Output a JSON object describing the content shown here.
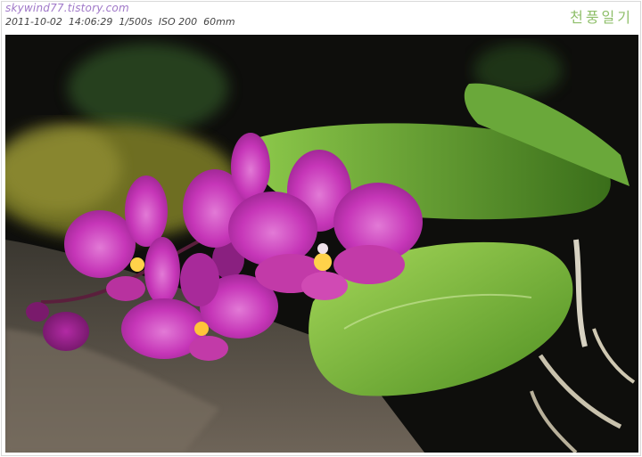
{
  "header": {
    "site_url": "skywind77.tistory.com",
    "exif_text": "2011-10-02  14:06:29  1/500s  ISO 200  60mm",
    "logo_text": "천풍일기"
  },
  "photo": {
    "subject": "pink-orchid",
    "colors": {
      "petal": "#c636b8",
      "petal_light": "#d85ccc",
      "petal_dark": "#8a1f7e",
      "leaf": "#7fbf3c",
      "leaf_dark": "#3f7a1e",
      "moss": "#8a8a2a",
      "background": "#0e0e0c",
      "ground": "#6e6458"
    }
  }
}
